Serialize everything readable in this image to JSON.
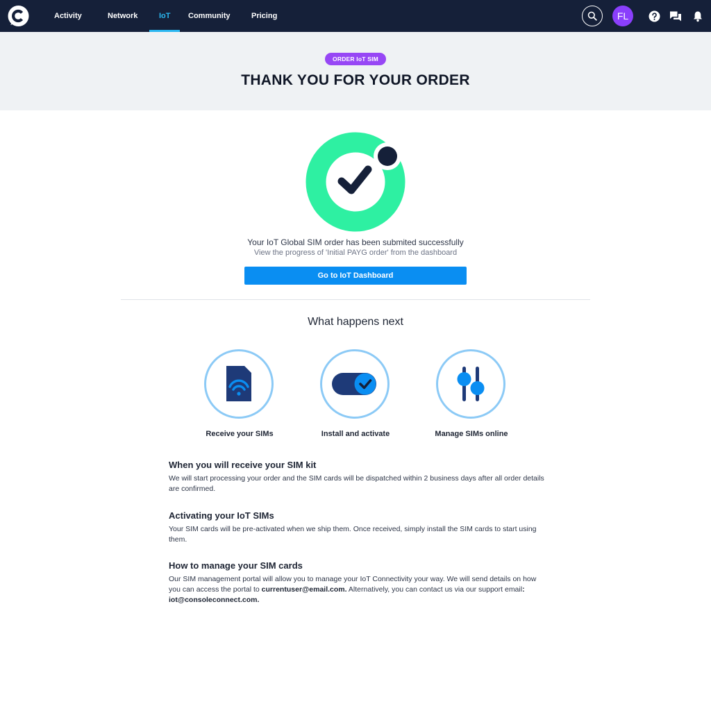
{
  "nav": {
    "links": [
      "Activity",
      "Network",
      "IoT",
      "Community",
      "Pricing"
    ],
    "active": "IoT",
    "avatar_initials": "FL",
    "icons": [
      "search-icon",
      "help-icon",
      "chat-icon",
      "bell-icon"
    ]
  },
  "header": {
    "badge": "ORDER IoT SIM",
    "title": "THANK YOU FOR YOUR ORDER"
  },
  "success": {
    "message": "Your IoT Global SIM order has been submited successfully",
    "sub_message": "View the progress of 'Initial PAYG order' from the dashboard",
    "button_label": "Go to IoT Dashboard"
  },
  "next": {
    "title": "What happens next",
    "steps": [
      {
        "label": "Receive your SIMs",
        "icon": "sim-card-icon"
      },
      {
        "label": "Install and activate",
        "icon": "toggle-icon"
      },
      {
        "label": "Manage SIMs online",
        "icon": "sliders-icon"
      }
    ]
  },
  "info": [
    {
      "heading": "When you will receive your SIM kit",
      "body": "We will start processing your order and the SIM cards will be dispatched within 2 business days after all order details are confirmed."
    },
    {
      "heading": "Activating your IoT SIMs",
      "body": "Your SIM cards will be pre-activated when we ship them. Once received, simply install the SIM cards to start using them."
    },
    {
      "heading": "How to manage your SIM cards",
      "body_parts": {
        "part1": "Our SIM management portal will allow you to manage your IoT Connectivity your way.  We will send details on how you can access the portal to ",
        "email_user": "currentuser@email.com.",
        "part2": " Alternatively, you can contact us via our support email",
        "colon": ":",
        "email_support": " iot@consoleconnect.com."
      }
    }
  ],
  "colors": {
    "nav_bg": "#152039",
    "accent": "#2ab7f0",
    "badge": "#9747f5",
    "button": "#0a8ef2",
    "success_ring": "#2ef0a2",
    "icon_blue": "#0a8ef2",
    "icon_navy": "#1e3a78"
  }
}
